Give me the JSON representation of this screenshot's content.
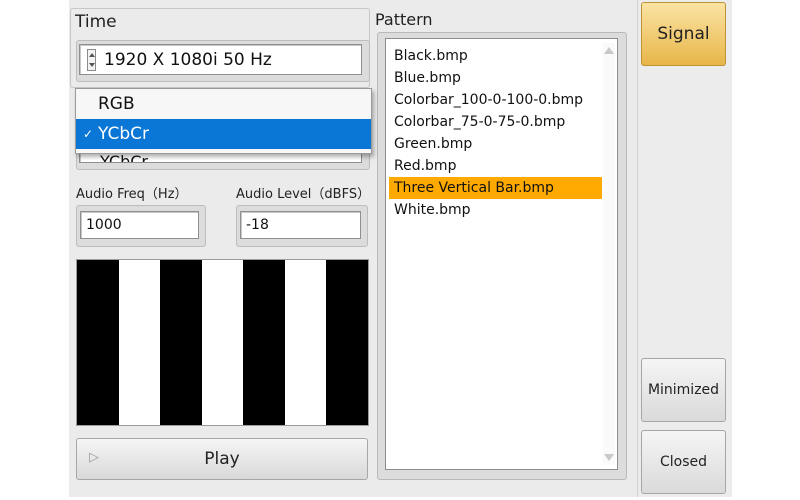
{
  "time": {
    "label": "Time",
    "resolution_value": "1920 X 1080i 50 Hz"
  },
  "color_space": {
    "hidden_value": "YCbCr",
    "options": [
      "RGB",
      "YCbCr"
    ],
    "selected": "YCbCr"
  },
  "audio": {
    "freq_label": "Audio Freq（Hz）",
    "freq_value": "1000",
    "level_label": "Audio Level（dBFS）",
    "level_value": "-18"
  },
  "preview": {
    "pattern": "Three Vertical Bar",
    "bar_colors": [
      "#000000",
      "#ffffff",
      "#000000",
      "#ffffff",
      "#000000",
      "#ffffff",
      "#000000"
    ]
  },
  "play_button": {
    "label": "Play",
    "icon": "play-icon"
  },
  "pattern": {
    "label": "Pattern",
    "items": [
      "Black.bmp",
      "Blue.bmp",
      "Colorbar_100-0-100-0.bmp",
      "Colorbar_75-0-75-0.bmp",
      "Green.bmp",
      "Red.bmp",
      "Three Vertical Bar.bmp",
      "White.bmp"
    ],
    "selected_index": 6,
    "highlight_color": "#ffaa00"
  },
  "side_buttons": {
    "signal": "Signal",
    "minimized": "Minimized",
    "closed": "Closed"
  },
  "colors": {
    "accent_selection": "#0a76d6",
    "signal_active": "#e7b64a"
  }
}
